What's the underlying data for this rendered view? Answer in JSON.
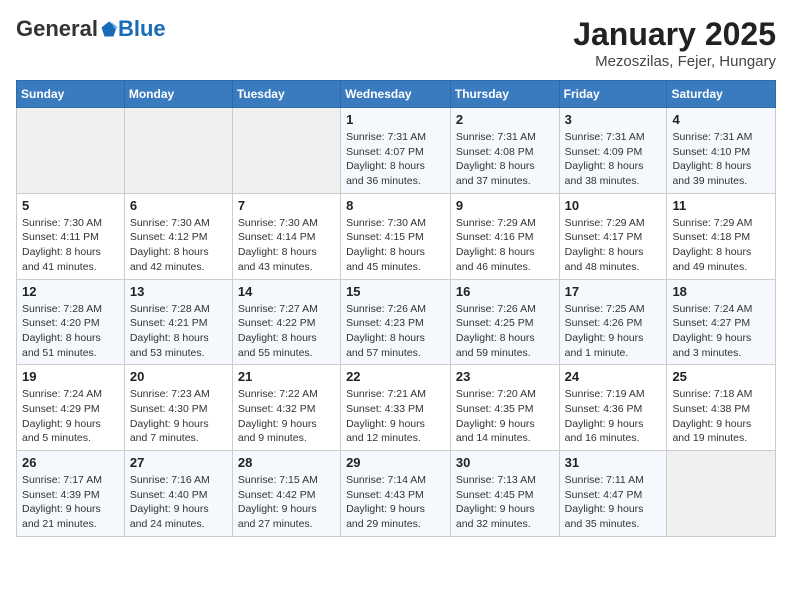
{
  "header": {
    "logo_general": "General",
    "logo_blue": "Blue",
    "month": "January 2025",
    "location": "Mezoszilas, Fejer, Hungary"
  },
  "days_of_week": [
    "Sunday",
    "Monday",
    "Tuesday",
    "Wednesday",
    "Thursday",
    "Friday",
    "Saturday"
  ],
  "weeks": [
    [
      {
        "day": "",
        "info": ""
      },
      {
        "day": "",
        "info": ""
      },
      {
        "day": "",
        "info": ""
      },
      {
        "day": "1",
        "info": "Sunrise: 7:31 AM\nSunset: 4:07 PM\nDaylight: 8 hours and 36 minutes."
      },
      {
        "day": "2",
        "info": "Sunrise: 7:31 AM\nSunset: 4:08 PM\nDaylight: 8 hours and 37 minutes."
      },
      {
        "day": "3",
        "info": "Sunrise: 7:31 AM\nSunset: 4:09 PM\nDaylight: 8 hours and 38 minutes."
      },
      {
        "day": "4",
        "info": "Sunrise: 7:31 AM\nSunset: 4:10 PM\nDaylight: 8 hours and 39 minutes."
      }
    ],
    [
      {
        "day": "5",
        "info": "Sunrise: 7:30 AM\nSunset: 4:11 PM\nDaylight: 8 hours and 41 minutes."
      },
      {
        "day": "6",
        "info": "Sunrise: 7:30 AM\nSunset: 4:12 PM\nDaylight: 8 hours and 42 minutes."
      },
      {
        "day": "7",
        "info": "Sunrise: 7:30 AM\nSunset: 4:14 PM\nDaylight: 8 hours and 43 minutes."
      },
      {
        "day": "8",
        "info": "Sunrise: 7:30 AM\nSunset: 4:15 PM\nDaylight: 8 hours and 45 minutes."
      },
      {
        "day": "9",
        "info": "Sunrise: 7:29 AM\nSunset: 4:16 PM\nDaylight: 8 hours and 46 minutes."
      },
      {
        "day": "10",
        "info": "Sunrise: 7:29 AM\nSunset: 4:17 PM\nDaylight: 8 hours and 48 minutes."
      },
      {
        "day": "11",
        "info": "Sunrise: 7:29 AM\nSunset: 4:18 PM\nDaylight: 8 hours and 49 minutes."
      }
    ],
    [
      {
        "day": "12",
        "info": "Sunrise: 7:28 AM\nSunset: 4:20 PM\nDaylight: 8 hours and 51 minutes."
      },
      {
        "day": "13",
        "info": "Sunrise: 7:28 AM\nSunset: 4:21 PM\nDaylight: 8 hours and 53 minutes."
      },
      {
        "day": "14",
        "info": "Sunrise: 7:27 AM\nSunset: 4:22 PM\nDaylight: 8 hours and 55 minutes."
      },
      {
        "day": "15",
        "info": "Sunrise: 7:26 AM\nSunset: 4:23 PM\nDaylight: 8 hours and 57 minutes."
      },
      {
        "day": "16",
        "info": "Sunrise: 7:26 AM\nSunset: 4:25 PM\nDaylight: 8 hours and 59 minutes."
      },
      {
        "day": "17",
        "info": "Sunrise: 7:25 AM\nSunset: 4:26 PM\nDaylight: 9 hours and 1 minute."
      },
      {
        "day": "18",
        "info": "Sunrise: 7:24 AM\nSunset: 4:27 PM\nDaylight: 9 hours and 3 minutes."
      }
    ],
    [
      {
        "day": "19",
        "info": "Sunrise: 7:24 AM\nSunset: 4:29 PM\nDaylight: 9 hours and 5 minutes."
      },
      {
        "day": "20",
        "info": "Sunrise: 7:23 AM\nSunset: 4:30 PM\nDaylight: 9 hours and 7 minutes."
      },
      {
        "day": "21",
        "info": "Sunrise: 7:22 AM\nSunset: 4:32 PM\nDaylight: 9 hours and 9 minutes."
      },
      {
        "day": "22",
        "info": "Sunrise: 7:21 AM\nSunset: 4:33 PM\nDaylight: 9 hours and 12 minutes."
      },
      {
        "day": "23",
        "info": "Sunrise: 7:20 AM\nSunset: 4:35 PM\nDaylight: 9 hours and 14 minutes."
      },
      {
        "day": "24",
        "info": "Sunrise: 7:19 AM\nSunset: 4:36 PM\nDaylight: 9 hours and 16 minutes."
      },
      {
        "day": "25",
        "info": "Sunrise: 7:18 AM\nSunset: 4:38 PM\nDaylight: 9 hours and 19 minutes."
      }
    ],
    [
      {
        "day": "26",
        "info": "Sunrise: 7:17 AM\nSunset: 4:39 PM\nDaylight: 9 hours and 21 minutes."
      },
      {
        "day": "27",
        "info": "Sunrise: 7:16 AM\nSunset: 4:40 PM\nDaylight: 9 hours and 24 minutes."
      },
      {
        "day": "28",
        "info": "Sunrise: 7:15 AM\nSunset: 4:42 PM\nDaylight: 9 hours and 27 minutes."
      },
      {
        "day": "29",
        "info": "Sunrise: 7:14 AM\nSunset: 4:43 PM\nDaylight: 9 hours and 29 minutes."
      },
      {
        "day": "30",
        "info": "Sunrise: 7:13 AM\nSunset: 4:45 PM\nDaylight: 9 hours and 32 minutes."
      },
      {
        "day": "31",
        "info": "Sunrise: 7:11 AM\nSunset: 4:47 PM\nDaylight: 9 hours and 35 minutes."
      },
      {
        "day": "",
        "info": ""
      }
    ]
  ]
}
